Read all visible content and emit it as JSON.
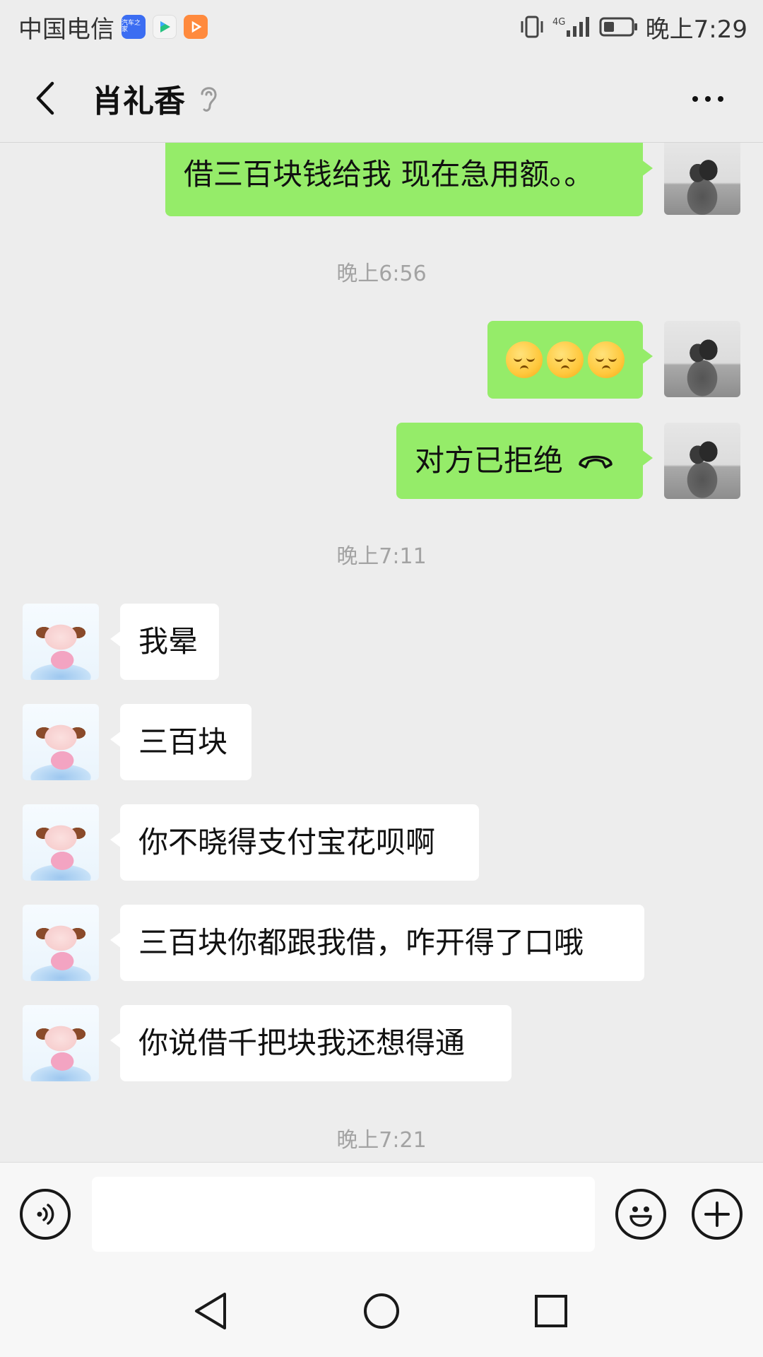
{
  "status_bar": {
    "carrier": "中国电信",
    "app_icons": [
      "autohome-icon",
      "video-play-icon",
      "orange-video-icon"
    ],
    "autohome_badge_text": "汽车之家",
    "network": "4G",
    "time": "晚上7:29"
  },
  "header": {
    "contact_name": "肖礼香",
    "back_icon": "chevron-left-icon",
    "ear_icon": "earpiece-mode-icon",
    "more_icon": "more-dots-icon"
  },
  "messages": [
    {
      "side": "out",
      "type": "text",
      "text": "借三百块钱给我 现在急用额。。"
    },
    {
      "type": "timestamp",
      "text": "晚上6:56"
    },
    {
      "side": "out",
      "type": "emoji",
      "emoji_names": [
        "relieved-face-emoji",
        "relieved-face-emoji",
        "relieved-face-emoji"
      ]
    },
    {
      "side": "out",
      "type": "call",
      "text": "对方已拒绝",
      "icon": "hang-up-icon"
    },
    {
      "type": "timestamp",
      "text": "晚上7:11"
    },
    {
      "side": "in",
      "type": "text",
      "text": "我晕"
    },
    {
      "side": "in",
      "type": "text",
      "text": "三百块"
    },
    {
      "side": "in",
      "type": "text",
      "text": "你不晓得支付宝花呗啊"
    },
    {
      "side": "in",
      "type": "text",
      "text": "三百块你都跟我借，咋开得了口哦"
    },
    {
      "side": "in",
      "type": "text",
      "text": "你说借千把块我还想得通"
    },
    {
      "type": "timestamp",
      "text": "晚上7:21"
    }
  ],
  "input_bar": {
    "voice_icon": "voice-input-icon",
    "input_value": "",
    "emoji_icon": "emoji-smile-icon",
    "plus_icon": "plus-icon"
  },
  "nav_bar": {
    "back_icon": "triangle-back-icon",
    "home_icon": "circle-home-icon",
    "recents_icon": "square-recents-icon"
  },
  "colors": {
    "outgoing_bubble": "#95ec69",
    "incoming_bubble": "#ffffff",
    "chat_background": "#ededed",
    "timestamp_text": "#a3a3a3"
  }
}
